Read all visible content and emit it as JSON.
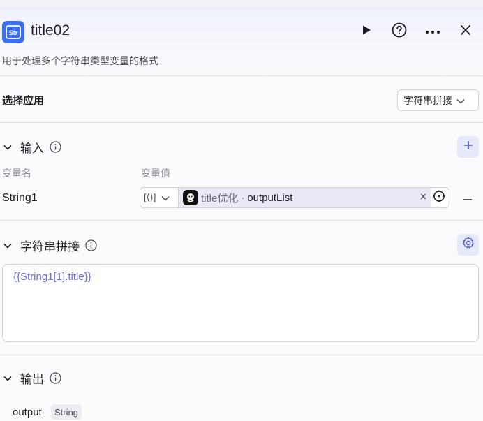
{
  "header": {
    "icon": "string-node-icon",
    "icon_text": "Str",
    "title": "title02",
    "description": "用于处理多个字符串类型变量的格式",
    "actions": [
      "play-icon",
      "help-icon",
      "more-icon",
      "close-icon"
    ]
  },
  "app_select": {
    "label": "选择应用",
    "value": "字符串拼接"
  },
  "input": {
    "title": "输入",
    "col_name": "变量名",
    "col_value": "变量值",
    "rows": [
      {
        "name": "String1",
        "type_symbol": "[⟨⟩]",
        "ref_node": "title优化",
        "ref_sep": "·",
        "ref_var": "outputList"
      }
    ]
  },
  "concat": {
    "title": "字符串拼接",
    "template": "{{String1[1].title}}"
  },
  "output": {
    "title": "输出",
    "name": "output",
    "type": "String"
  },
  "colors": {
    "accent": "#3a6ff2",
    "template_text": "#6a6fd6",
    "button_bg": "#e6e8fb"
  }
}
